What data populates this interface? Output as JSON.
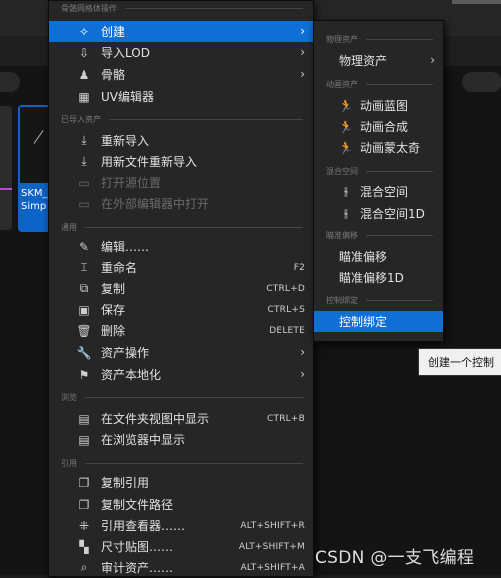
{
  "background": {
    "asset_tile": {
      "name_line1": "SKM_",
      "name_line2": "Simp"
    }
  },
  "main_menu": {
    "sections": {
      "skeletal_mesh_ops": "骨骼网格体操作",
      "imported_asset": "已导入资产",
      "general": "通用",
      "browse": "浏览",
      "references": "引用"
    },
    "items": {
      "create": {
        "label": "创建",
        "icon": "create-wand-icon"
      },
      "import_lod": {
        "label": "导入LOD",
        "icon": "import-icon"
      },
      "skeleton": {
        "label": "骨骼",
        "icon": "skeleton-icon"
      },
      "uv_editor": {
        "label": "UV编辑器",
        "icon": "uv-grid-icon"
      },
      "reimport": {
        "label": "重新导入",
        "icon": "reimport-icon"
      },
      "reimport_new_file": {
        "label": "用新文件重新导入",
        "icon": "reimport-icon"
      },
      "open_source_location": {
        "label": "打开源位置",
        "icon": "folder-icon"
      },
      "open_in_external_editor": {
        "label": "在外部编辑器中打开",
        "icon": "external-editor-icon"
      },
      "edit": {
        "label": "编辑……",
        "icon": "pencil-icon"
      },
      "rename": {
        "label": "重命名",
        "icon": "rename-icon",
        "shortcut": "F2"
      },
      "duplicate": {
        "label": "复制",
        "icon": "duplicate-icon",
        "shortcut": "CTRL+D"
      },
      "save": {
        "label": "保存",
        "icon": "save-icon",
        "shortcut": "CTRL+S"
      },
      "delete": {
        "label": "删除",
        "icon": "trash-icon",
        "shortcut": "DELETE"
      },
      "asset_actions": {
        "label": "资产操作",
        "icon": "wrench-icon"
      },
      "asset_localization": {
        "label": "资产本地化",
        "icon": "flag-icon"
      },
      "show_in_folder": {
        "label": "在文件夹视图中显示",
        "icon": "folder-search-icon",
        "shortcut": "CTRL+B"
      },
      "show_in_browser": {
        "label": "在浏览器中显示",
        "icon": "folder-search-icon"
      },
      "copy_reference": {
        "label": "复制引用",
        "icon": "copy-icon"
      },
      "copy_file_path": {
        "label": "复制文件路径",
        "icon": "copy-icon"
      },
      "reference_viewer": {
        "label": "引用查看器……",
        "icon": "reference-viewer-icon",
        "shortcut": "ALT+SHIFT+R"
      },
      "size_map": {
        "label": "尺寸贴图……",
        "icon": "size-map-icon",
        "shortcut": "ALT+SHIFT+M"
      },
      "audit_asset": {
        "label": "审计资产……",
        "icon": "audit-search-icon",
        "shortcut": "ALT+SHIFT+A"
      }
    }
  },
  "sub_menu": {
    "sections": {
      "physics_asset": "物理资产",
      "animation_asset": "动画资产",
      "blend_space": "混合空间",
      "aim_offset": "瞄准偏移",
      "control_rig": "控制绑定"
    },
    "items": {
      "physics_asset": {
        "label": "物理资产"
      },
      "anim_blueprint": {
        "label": "动画蓝图",
        "icon": "anim-blueprint-icon"
      },
      "anim_composite": {
        "label": "动画合成",
        "icon": "anim-composite-icon"
      },
      "anim_montage": {
        "label": "动画蒙太奇",
        "icon": "anim-montage-icon"
      },
      "blend_space": {
        "label": "混合空间",
        "icon": "blend-space-icon"
      },
      "blend_space_1d": {
        "label": "混合空间1D",
        "icon": "blend-space-1d-icon"
      },
      "aim_offset": {
        "label": "瞄准偏移"
      },
      "aim_offset_1d": {
        "label": "瞄准偏移1D"
      },
      "control_rig": {
        "label": "控制绑定"
      }
    }
  },
  "tooltip": {
    "text": "创建一个控制"
  },
  "watermark": {
    "text": "CSDN @一支飞编程"
  }
}
